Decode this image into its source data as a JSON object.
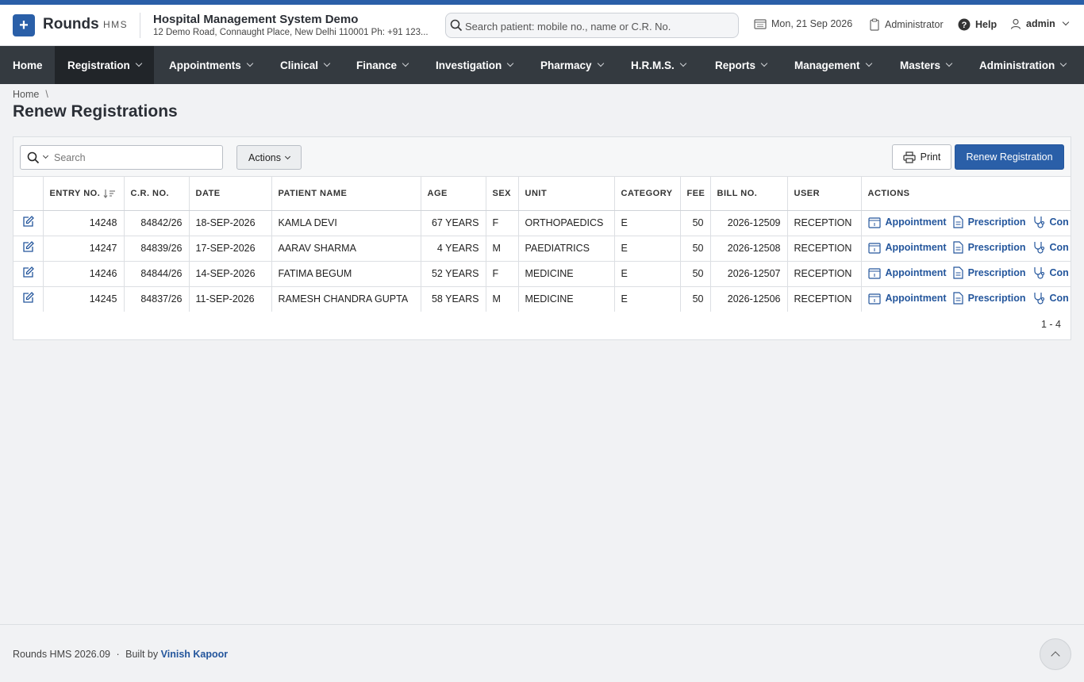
{
  "brand": {
    "name": "Rounds",
    "sub": "HMS",
    "logo_icon": "plus-icon"
  },
  "org": {
    "name": "Hospital Management System Demo",
    "address": "12 Demo Road, Connaught Place, New Delhi 110001 Ph: +91 123..."
  },
  "search": {
    "placeholder": "Search patient: mobile no., name or C.R. No."
  },
  "header": {
    "date": "Mon, 21 Sep 2026",
    "role": "Administrator",
    "help": "Help",
    "user": "admin"
  },
  "nav": {
    "items": [
      {
        "label": "Home"
      },
      {
        "label": "Registration"
      },
      {
        "label": "Appointments"
      },
      {
        "label": "Clinical"
      },
      {
        "label": "Finance"
      },
      {
        "label": "Investigation"
      },
      {
        "label": "Pharmacy"
      },
      {
        "label": "H.R.M.S."
      },
      {
        "label": "Reports"
      },
      {
        "label": "Management"
      },
      {
        "label": "Masters"
      },
      {
        "label": "Administration"
      }
    ],
    "active": "Registration"
  },
  "breadcrumb": {
    "home": "Home",
    "separator": "\\"
  },
  "page": {
    "title": "Renew Registrations"
  },
  "toolbar": {
    "search_placeholder": "Search",
    "actions_label": "Actions",
    "print_label": "Print",
    "renew_label": "Renew Registration"
  },
  "table": {
    "columns": [
      "",
      "ENTRY NO.",
      "C.R. NO.",
      "DATE",
      "PATIENT NAME",
      "AGE",
      "SEX",
      "UNIT",
      "CATEGORY",
      "FEE",
      "BILL NO.",
      "USER",
      "ACTIONS"
    ],
    "rows": [
      {
        "entry": "14248",
        "cr": "84842/26",
        "date": "18-SEP-2026",
        "name": "KAMLA DEVI",
        "age": "67 YEARS",
        "sex": "F",
        "unit": "ORTHOPAEDICS",
        "category": "E",
        "fee": "50",
        "bill": "2026-12509",
        "user": "RECEPTION"
      },
      {
        "entry": "14247",
        "cr": "84839/26",
        "date": "17-SEP-2026",
        "name": "AARAV SHARMA",
        "age": "4 YEARS",
        "sex": "M",
        "unit": "PAEDIATRICS",
        "category": "E",
        "fee": "50",
        "bill": "2026-12508",
        "user": "RECEPTION"
      },
      {
        "entry": "14246",
        "cr": "84844/26",
        "date": "14-SEP-2026",
        "name": "FATIMA BEGUM",
        "age": "52 YEARS",
        "sex": "F",
        "unit": "MEDICINE",
        "category": "E",
        "fee": "50",
        "bill": "2026-12507",
        "user": "RECEPTION"
      },
      {
        "entry": "14245",
        "cr": "84837/26",
        "date": "11-SEP-2026",
        "name": "RAMESH CHANDRA GUPTA",
        "age": "58 YEARS",
        "sex": "M",
        "unit": "MEDICINE",
        "category": "E",
        "fee": "50",
        "bill": "2026-12506",
        "user": "RECEPTION"
      }
    ],
    "row_actions": [
      "Appointment",
      "Prescription",
      "Con"
    ],
    "pager": "1 - 4"
  },
  "footer": {
    "version": "Rounds HMS 2026.09",
    "dot": "·",
    "built_by": "Built by",
    "author": "Vinish Kapoor"
  },
  "colors": {
    "brand": "#2a5fa8",
    "navbar": "#343a40",
    "nav_active": "#212529",
    "link": "#24569c"
  }
}
